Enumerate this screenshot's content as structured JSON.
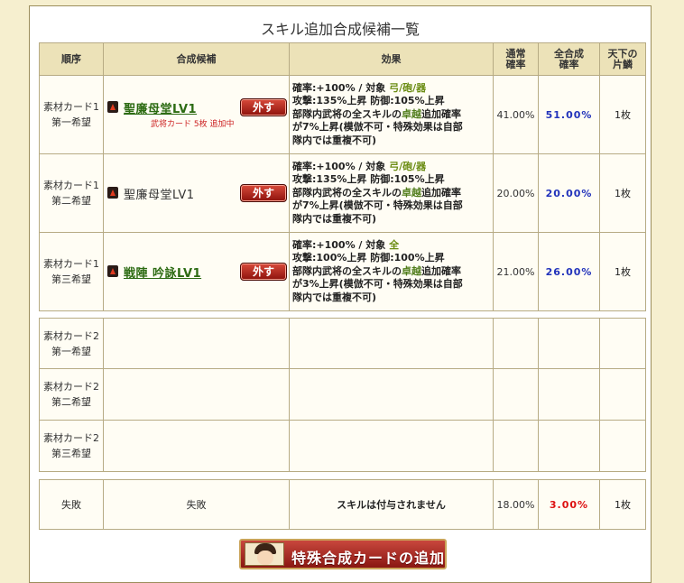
{
  "title": "スキル追加合成候補一覧",
  "headers": {
    "order": "順序",
    "candidate": "合成候補",
    "effect": "効果",
    "normal_rate": [
      "通常",
      "確率"
    ],
    "total_rate": [
      "全合成",
      "確率"
    ],
    "fragment": [
      "天下の",
      "片鱗"
    ]
  },
  "card1_rows": [
    {
      "order": [
        "素材カード1",
        "第一希望"
      ],
      "skill": "聖廉母堂LV1",
      "note": "武将カード 5枚 追加中",
      "remove": "外す",
      "effect": {
        "line1_pre": "確率:+100% / 対象 ",
        "target": "弓/砲/器",
        "line2": "攻撃:135%上昇 防御:105%上昇",
        "line3_pre": "部隊内武将の全スキルの",
        "hl": "卓越",
        "line3_post": "追加確率",
        "line4": "が7%上昇(模倣不可・特殊効果は自部",
        "line5": "隊内では重複不可)"
      },
      "normal_rate": "41.00%",
      "total_rate": "51.00%",
      "count": "1枚"
    },
    {
      "order": [
        "素材カード1",
        "第二希望"
      ],
      "skill": "聖廉母堂LV1",
      "note": "",
      "remove": "外す",
      "effect": {
        "line1_pre": "確率:+100% / 対象 ",
        "target": "弓/砲/器",
        "line2": "攻撃:135%上昇 防御:105%上昇",
        "line3_pre": "部隊内武将の全スキルの",
        "hl": "卓越",
        "line3_post": "追加確率",
        "line4": "が7%上昇(模倣不可・特殊効果は自部",
        "line5": "隊内では重複不可)"
      },
      "normal_rate": "20.00%",
      "total_rate": "20.00%",
      "count": "1枚"
    },
    {
      "order": [
        "素材カード1",
        "第三希望"
      ],
      "skill": "戦陣 吟詠LV1",
      "note": "",
      "remove": "外す",
      "effect": {
        "line1_pre": "確率:+100% / 対象 ",
        "target": "全",
        "line2": "攻撃:100%上昇 防御:100%上昇",
        "line3_pre": "部隊内武将の全スキルの",
        "hl": "卓越",
        "line3_post": "追加確率",
        "line4": "が3%上昇(模倣不可・特殊効果は自部",
        "line5": "隊内では重複不可)"
      },
      "normal_rate": "21.00%",
      "total_rate": "26.00%",
      "count": "1枚"
    }
  ],
  "card2_rows": [
    {
      "order": [
        "素材カード2",
        "第一希望"
      ]
    },
    {
      "order": [
        "素材カード2",
        "第二希望"
      ]
    },
    {
      "order": [
        "素材カード2",
        "第三希望"
      ]
    }
  ],
  "fail_row": {
    "order": "失敗",
    "candidate": "失敗",
    "effect": "スキルは付与されません",
    "normal_rate": "18.00%",
    "total_rate": "3.00%",
    "count": "1枚"
  },
  "add_button_label": "特殊合成カードの追加",
  "colors": {
    "total_rate_blue": "#2233bb",
    "total_rate_red": "#dd1111",
    "skill_link": "#2c6b12",
    "header_bg": "#ece2b8"
  }
}
